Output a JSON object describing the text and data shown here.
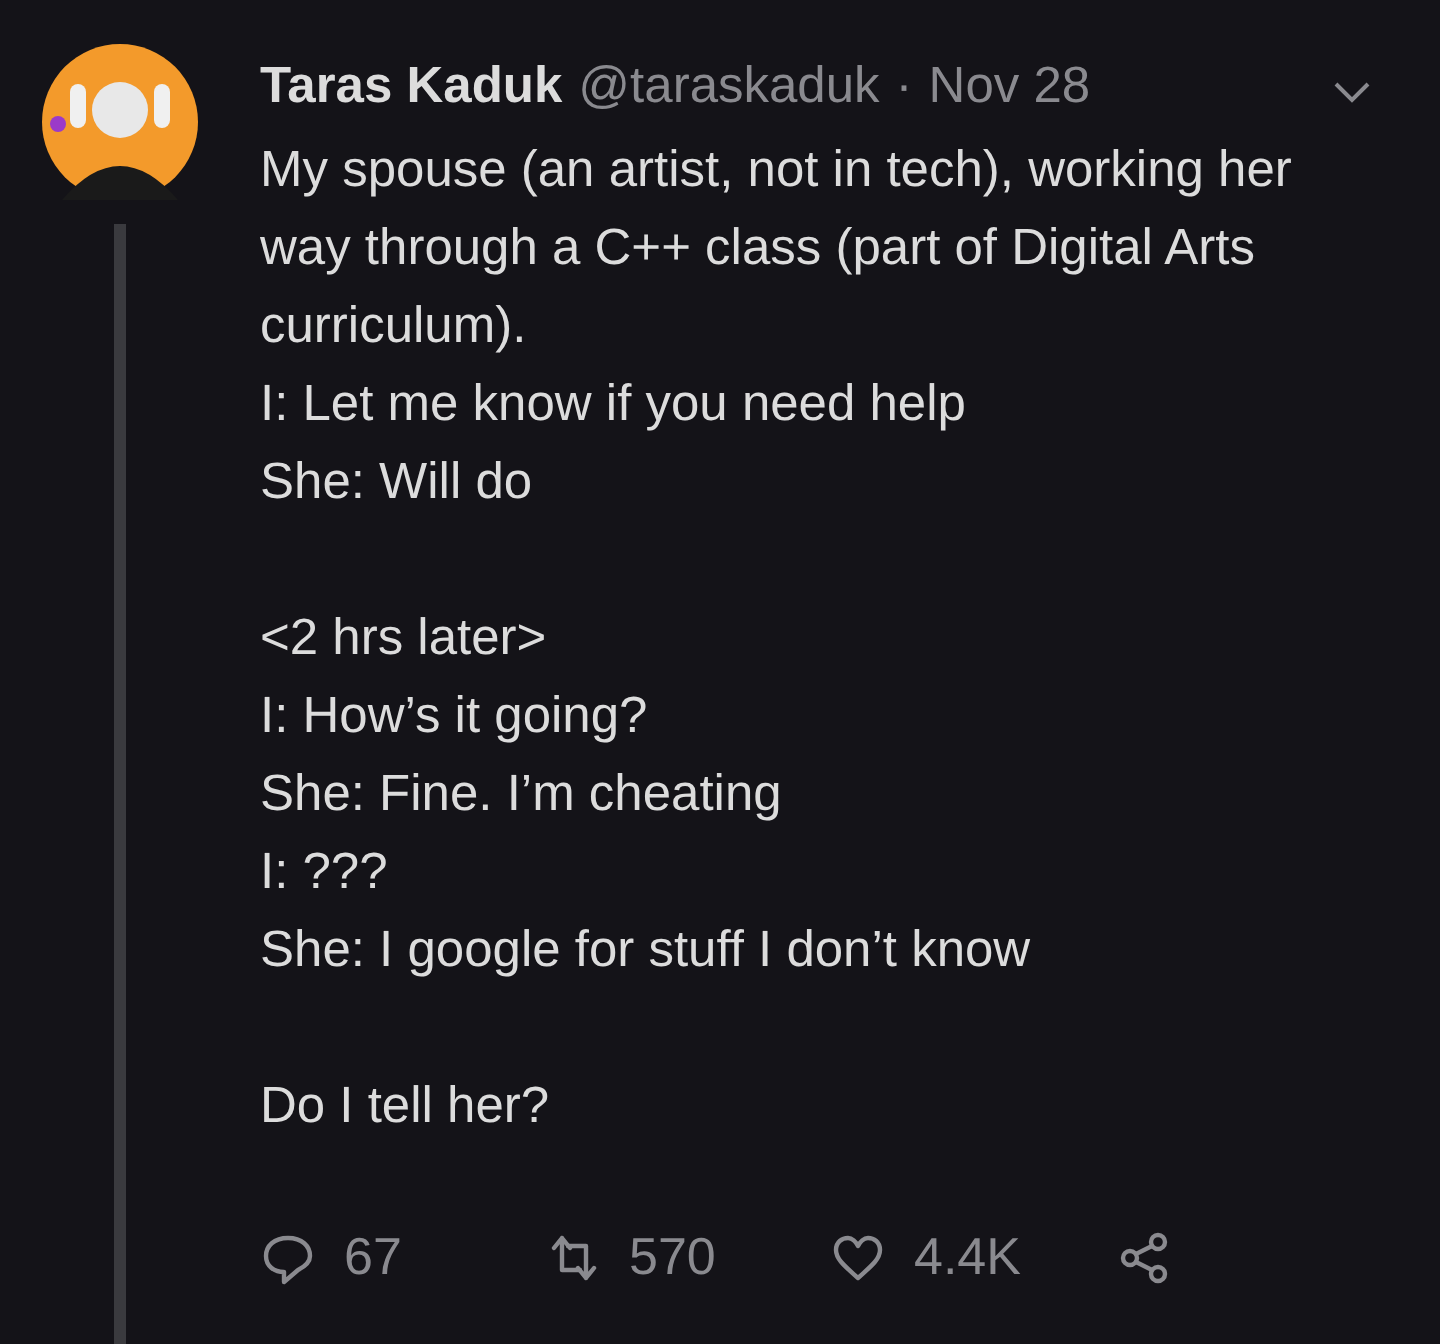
{
  "tweet": {
    "author": "Taras Kaduk",
    "handle": "@taraskaduk",
    "separator": "·",
    "date": "Nov 28",
    "paragraphs": [
      [
        "My spouse (an artist, not in tech), working her way through a C++ class (part of Digital Arts curriculum).",
        "I: Let me know if you need help",
        "She: Will do"
      ],
      [
        "<2 hrs later>",
        "I: How’s it going?",
        "She: Fine. I’m cheating",
        "I: ???",
        "She: I google for stuff I don’t know"
      ],
      [
        "Do I tell her?"
      ]
    ],
    "actions": [
      {
        "kind": "reply",
        "count": "67"
      },
      {
        "kind": "retweet",
        "count": "570"
      },
      {
        "kind": "like",
        "count": "4.4K"
      },
      {
        "kind": "share"
      }
    ]
  }
}
